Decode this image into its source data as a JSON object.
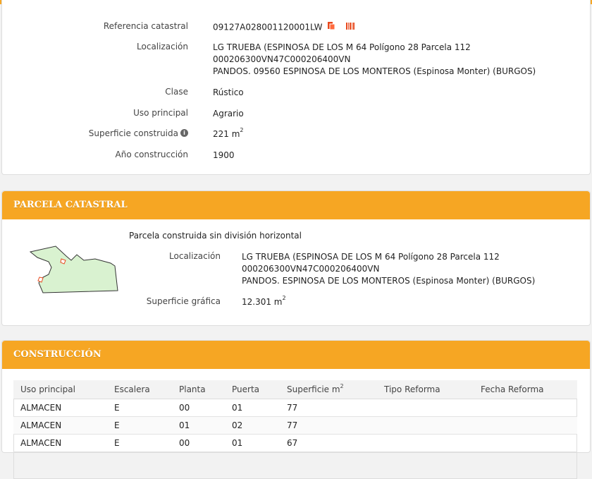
{
  "inmueble": {
    "referencia_label": "Referencia catastral",
    "referencia_value": "09127A028001120001LW",
    "localizacion_label": "Localización",
    "localizacion_lines": [
      "LG TRUEBA (ESPINOSA DE LOS M 64 Polígono 28 Parcela 112",
      "000206300VN47C000206400VN",
      "PANDOS. 09560 ESPINOSA DE LOS MONTEROS (Espinosa Monter) (BURGOS)"
    ],
    "clase_label": "Clase",
    "clase_value": "Rústico",
    "uso_label": "Uso principal",
    "uso_value": "Agrario",
    "superficie_label": "Superficie construida",
    "superficie_value": "221 m",
    "superficie_unit_exp": "2",
    "anio_label": "Año construcción",
    "anio_value": "1900"
  },
  "parcela": {
    "header": "PARCELA CATASTRAL",
    "tipo": "Parcela construida sin división horizontal",
    "localizacion_label": "Localización",
    "localizacion_lines": [
      "LG TRUEBA (ESPINOSA DE LOS M 64 Polígono 28 Parcela 112",
      "000206300VN47C000206400VN",
      "PANDOS. ESPINOSA DE LOS MONTEROS (Espinosa Monter) (BURGOS)"
    ],
    "superficie_label": "Superficie gráfica",
    "superficie_value": "12.301 m",
    "superficie_unit_exp": "2"
  },
  "construccion": {
    "header": "CONSTRUCCIÓN",
    "columns": [
      "Uso principal",
      "Escalera",
      "Planta",
      "Puerta",
      "Superficie m",
      "Tipo Reforma",
      "Fecha Reforma"
    ],
    "superficie_col_exp": "2",
    "rows": [
      [
        "ALMACEN",
        "E",
        "00",
        "01",
        "77",
        "",
        ""
      ],
      [
        "ALMACEN",
        "E",
        "01",
        "02",
        "77",
        "",
        ""
      ],
      [
        "ALMACEN",
        "E",
        "00",
        "01",
        "67",
        "",
        ""
      ]
    ]
  },
  "colors": {
    "accent": "#f6a623",
    "icon_red": "#e8491d",
    "parcel_fill": "#d9f2d0"
  },
  "icons": [
    "document-red-icon",
    "barcode-red-icon",
    "info-circle-icon"
  ]
}
